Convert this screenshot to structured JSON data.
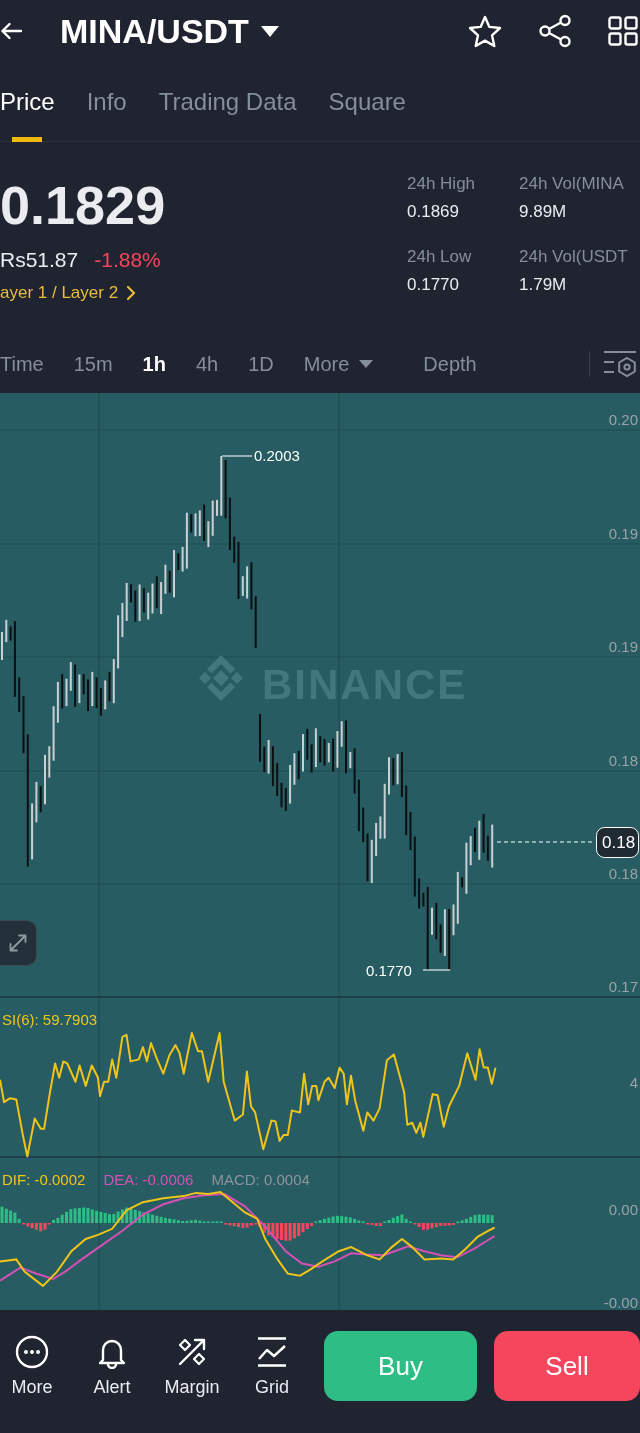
{
  "header": {
    "title": "MINA/USDT"
  },
  "tabs": [
    {
      "label": "Price",
      "selected": true
    },
    {
      "label": "Info",
      "selected": false
    },
    {
      "label": "Trading Data",
      "selected": false
    },
    {
      "label": "Square",
      "selected": false
    }
  ],
  "ticker": {
    "price": "0.1829",
    "fiat_price": "Rs51.87",
    "change": "-1.88%",
    "category": "ayer 1 / Layer 2"
  },
  "stats": [
    {
      "label": "24h High",
      "value": "0.1869"
    },
    {
      "label": "24h Vol(MINA",
      "value": "9.89M"
    },
    {
      "label": "24h Low",
      "value": "0.1770"
    },
    {
      "label": "24h Vol(USDT",
      "value": "1.79M"
    }
  ],
  "intervals": [
    {
      "label": "Time",
      "kind": "option",
      "selected": false
    },
    {
      "label": "15m",
      "kind": "option",
      "selected": false
    },
    {
      "label": "1h",
      "kind": "option",
      "selected": true
    },
    {
      "label": "4h",
      "kind": "option",
      "selected": false
    },
    {
      "label": "1D",
      "kind": "option",
      "selected": false
    },
    {
      "label": "More",
      "kind": "dropdown",
      "selected": false
    },
    {
      "label": "Depth",
      "kind": "view",
      "selected": false
    }
  ],
  "chart": {
    "watermark": "BINANCE",
    "price_axis": [
      "0.20",
      "0.19",
      "0.19",
      "0.18",
      "0.18",
      "0.17"
    ],
    "high_label": "0.2003",
    "low_label": "0.1770",
    "last_price": "0.18",
    "rsi": {
      "label": "SI(6): 59.7903",
      "axis": [
        "4"
      ]
    },
    "macd": {
      "legend": [
        {
          "text": "DIF: -0.0002",
          "color": "#f0c419"
        },
        {
          "text": "DEA: -0.0006",
          "color": "#d450b4"
        },
        {
          "text": "MACD: 0.0004",
          "color": "#8d959b"
        }
      ],
      "axis": [
        "0.00",
        "-0.00"
      ]
    }
  },
  "bottom_bar": {
    "actions": [
      {
        "label": "More",
        "kind": "more"
      },
      {
        "label": "Alert",
        "kind": "alert"
      },
      {
        "label": "Margin",
        "kind": "margin"
      },
      {
        "label": "Grid",
        "kind": "grid"
      }
    ],
    "buy": "Buy",
    "sell": "Sell"
  }
}
